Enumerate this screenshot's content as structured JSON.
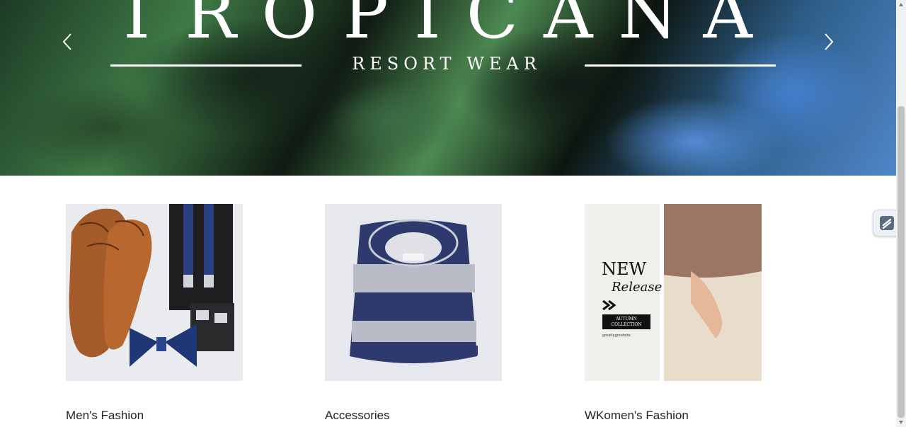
{
  "hero": {
    "brand": "TROPICANA",
    "tagline": "RESORT WEAR",
    "prev_icon": "chevron-left-icon",
    "next_icon": "chevron-right-icon"
  },
  "cards": [
    {
      "title": "Men's Fashion",
      "image": "shoes-suspenders-bowtie-photo"
    },
    {
      "title": "Accessories",
      "image": "folded-striped-sweater-photo"
    },
    {
      "title": "WKomen's Fashion",
      "image": "new-release-promo-photo",
      "promo": {
        "headline": "NEW",
        "script": "Release",
        "button": "AUTUMN COLLECTION",
        "site": "greatlygreatsite"
      }
    }
  ],
  "colors": {
    "navy": "#2e3a6e",
    "knit_gray": "#b9bcc6",
    "leather": "#a55a2a"
  }
}
